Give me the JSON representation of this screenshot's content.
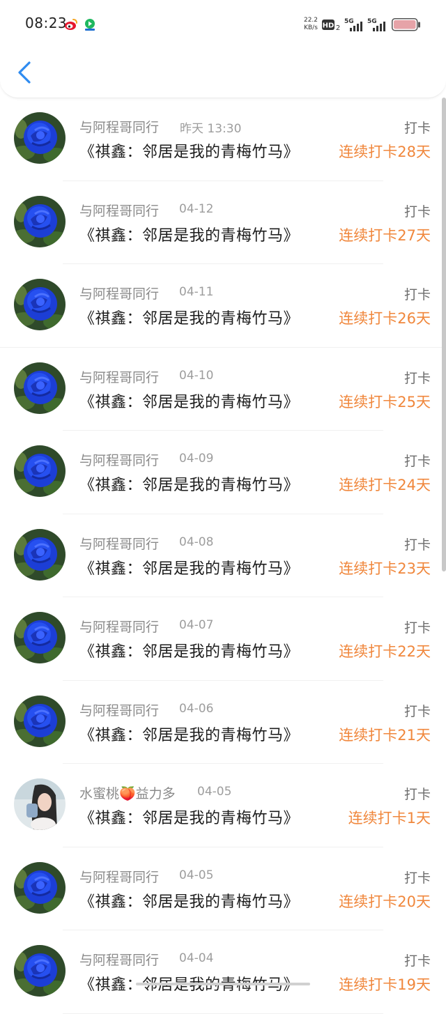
{
  "status_bar": {
    "time": "08:23",
    "net_speed_value": "22.2",
    "net_speed_unit": "KB/s",
    "hd_label": "HD",
    "hd_sub": "2",
    "signal1_label": "5G",
    "signal2_label": "5G",
    "icons": [
      "weibo-icon",
      "video-app-icon",
      "hd-voice-icon",
      "signal-icon",
      "signal-icon",
      "battery-icon"
    ],
    "battery_color": "#e6a3a8"
  },
  "header": {
    "back_icon": "chevron-left-icon",
    "accent": "#2e8bf0"
  },
  "colors": {
    "streak": "#f0873c",
    "username": "#8a8a8a",
    "title": "#1c1c1c"
  },
  "rows": [
    {
      "user": "与阿程哥同行",
      "date": "昨天 13:30",
      "title": "《祺鑫：邻居是我的青梅竹马》",
      "tag": "打卡",
      "streak": "连续打卡28天",
      "avatar": "blue-rose-avatar"
    },
    {
      "user": "与阿程哥同行",
      "date": "04-12",
      "title": "《祺鑫：邻居是我的青梅竹马》",
      "tag": "打卡",
      "streak": "连续打卡27天",
      "avatar": "blue-rose-avatar"
    },
    {
      "user": "与阿程哥同行",
      "date": "04-11",
      "title": "《祺鑫：邻居是我的青梅竹马》",
      "tag": "打卡",
      "streak": "连续打卡26天",
      "avatar": "blue-rose-avatar"
    },
    {
      "user": "与阿程哥同行",
      "date": "04-10",
      "title": "《祺鑫：邻居是我的青梅竹马》",
      "tag": "打卡",
      "streak": "连续打卡25天",
      "avatar": "blue-rose-avatar"
    },
    {
      "user": "与阿程哥同行",
      "date": "04-09",
      "title": "《祺鑫：邻居是我的青梅竹马》",
      "tag": "打卡",
      "streak": "连续打卡24天",
      "avatar": "blue-rose-avatar"
    },
    {
      "user": "与阿程哥同行",
      "date": "04-08",
      "title": "《祺鑫：邻居是我的青梅竹马》",
      "tag": "打卡",
      "streak": "连续打卡23天",
      "avatar": "blue-rose-avatar"
    },
    {
      "user": "与阿程哥同行",
      "date": "04-07",
      "title": "《祺鑫：邻居是我的青梅竹马》",
      "tag": "打卡",
      "streak": "连续打卡22天",
      "avatar": "blue-rose-avatar"
    },
    {
      "user": "与阿程哥同行",
      "date": "04-06",
      "title": "《祺鑫：邻居是我的青梅竹马》",
      "tag": "打卡",
      "streak": "连续打卡21天",
      "avatar": "blue-rose-avatar"
    },
    {
      "user": "水蜜桃🍑益力多",
      "date": "04-05",
      "title": "《祺鑫：邻居是我的青梅竹马》",
      "tag": "打卡",
      "streak": "连续打卡1天",
      "avatar": "girl-photo-avatar"
    },
    {
      "user": "与阿程哥同行",
      "date": "04-05",
      "title": "《祺鑫：邻居是我的青梅竹马》",
      "tag": "打卡",
      "streak": "连续打卡20天",
      "avatar": "blue-rose-avatar"
    },
    {
      "user": "与阿程哥同行",
      "date": "04-04",
      "title": "《祺鑫：邻居是我的青梅竹马》",
      "tag": "打卡",
      "streak": "连续打卡19天",
      "avatar": "blue-rose-avatar"
    }
  ]
}
